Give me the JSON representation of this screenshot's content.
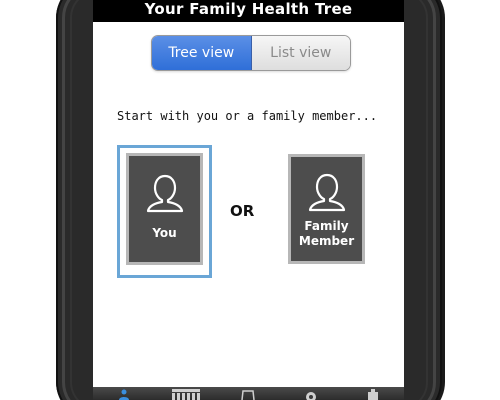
{
  "app": {
    "title": "Your Family Health Tree"
  },
  "view_toggle": {
    "tree_label": "Tree view",
    "list_label": "List view",
    "selected": "Tree view"
  },
  "main": {
    "prompt": "Start with you or a family member...",
    "or_label": "OR",
    "options": [
      {
        "label": "You",
        "icon": "person-icon",
        "selected": true
      },
      {
        "label": "Family\nMember",
        "icon": "person-icon",
        "selected": false
      }
    ]
  },
  "tabbar": {
    "items": [
      {
        "icon": "person-icon",
        "active": true
      },
      {
        "icon": "calendar-grid-icon",
        "active": false
      },
      {
        "icon": "bag-icon",
        "active": false
      },
      {
        "icon": "gear-icon",
        "active": false
      },
      {
        "icon": "more-icon",
        "active": false
      }
    ]
  },
  "colors": {
    "accent": "#2f6fd8",
    "selection": "#6aa6d6",
    "card": "#4d4d4d",
    "titlebar": "#000000"
  }
}
